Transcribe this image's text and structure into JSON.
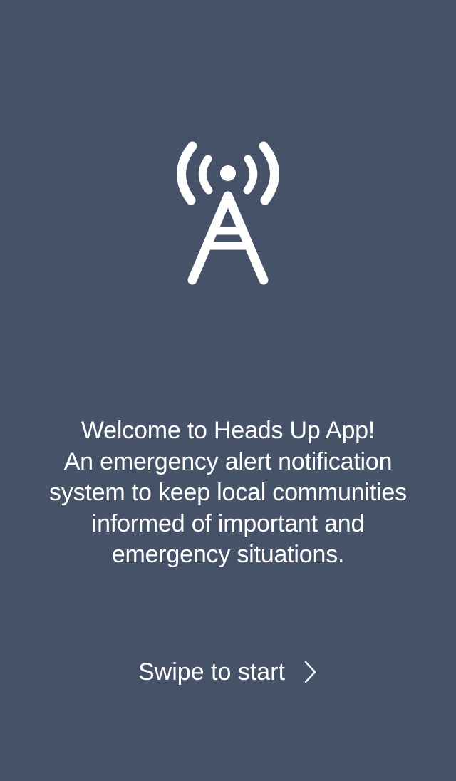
{
  "welcome": {
    "lines": [
      "Welcome to Heads Up App!",
      "An emergency alert notification",
      "system to keep local communities",
      "informed of important and",
      "emergency situations."
    ]
  },
  "swipe": {
    "label": "Swipe to start",
    "icon": "chevron-right-icon"
  },
  "logo": {
    "icon": "radio-tower-icon"
  },
  "colors": {
    "background": "#465267",
    "foreground": "#ffffff"
  }
}
